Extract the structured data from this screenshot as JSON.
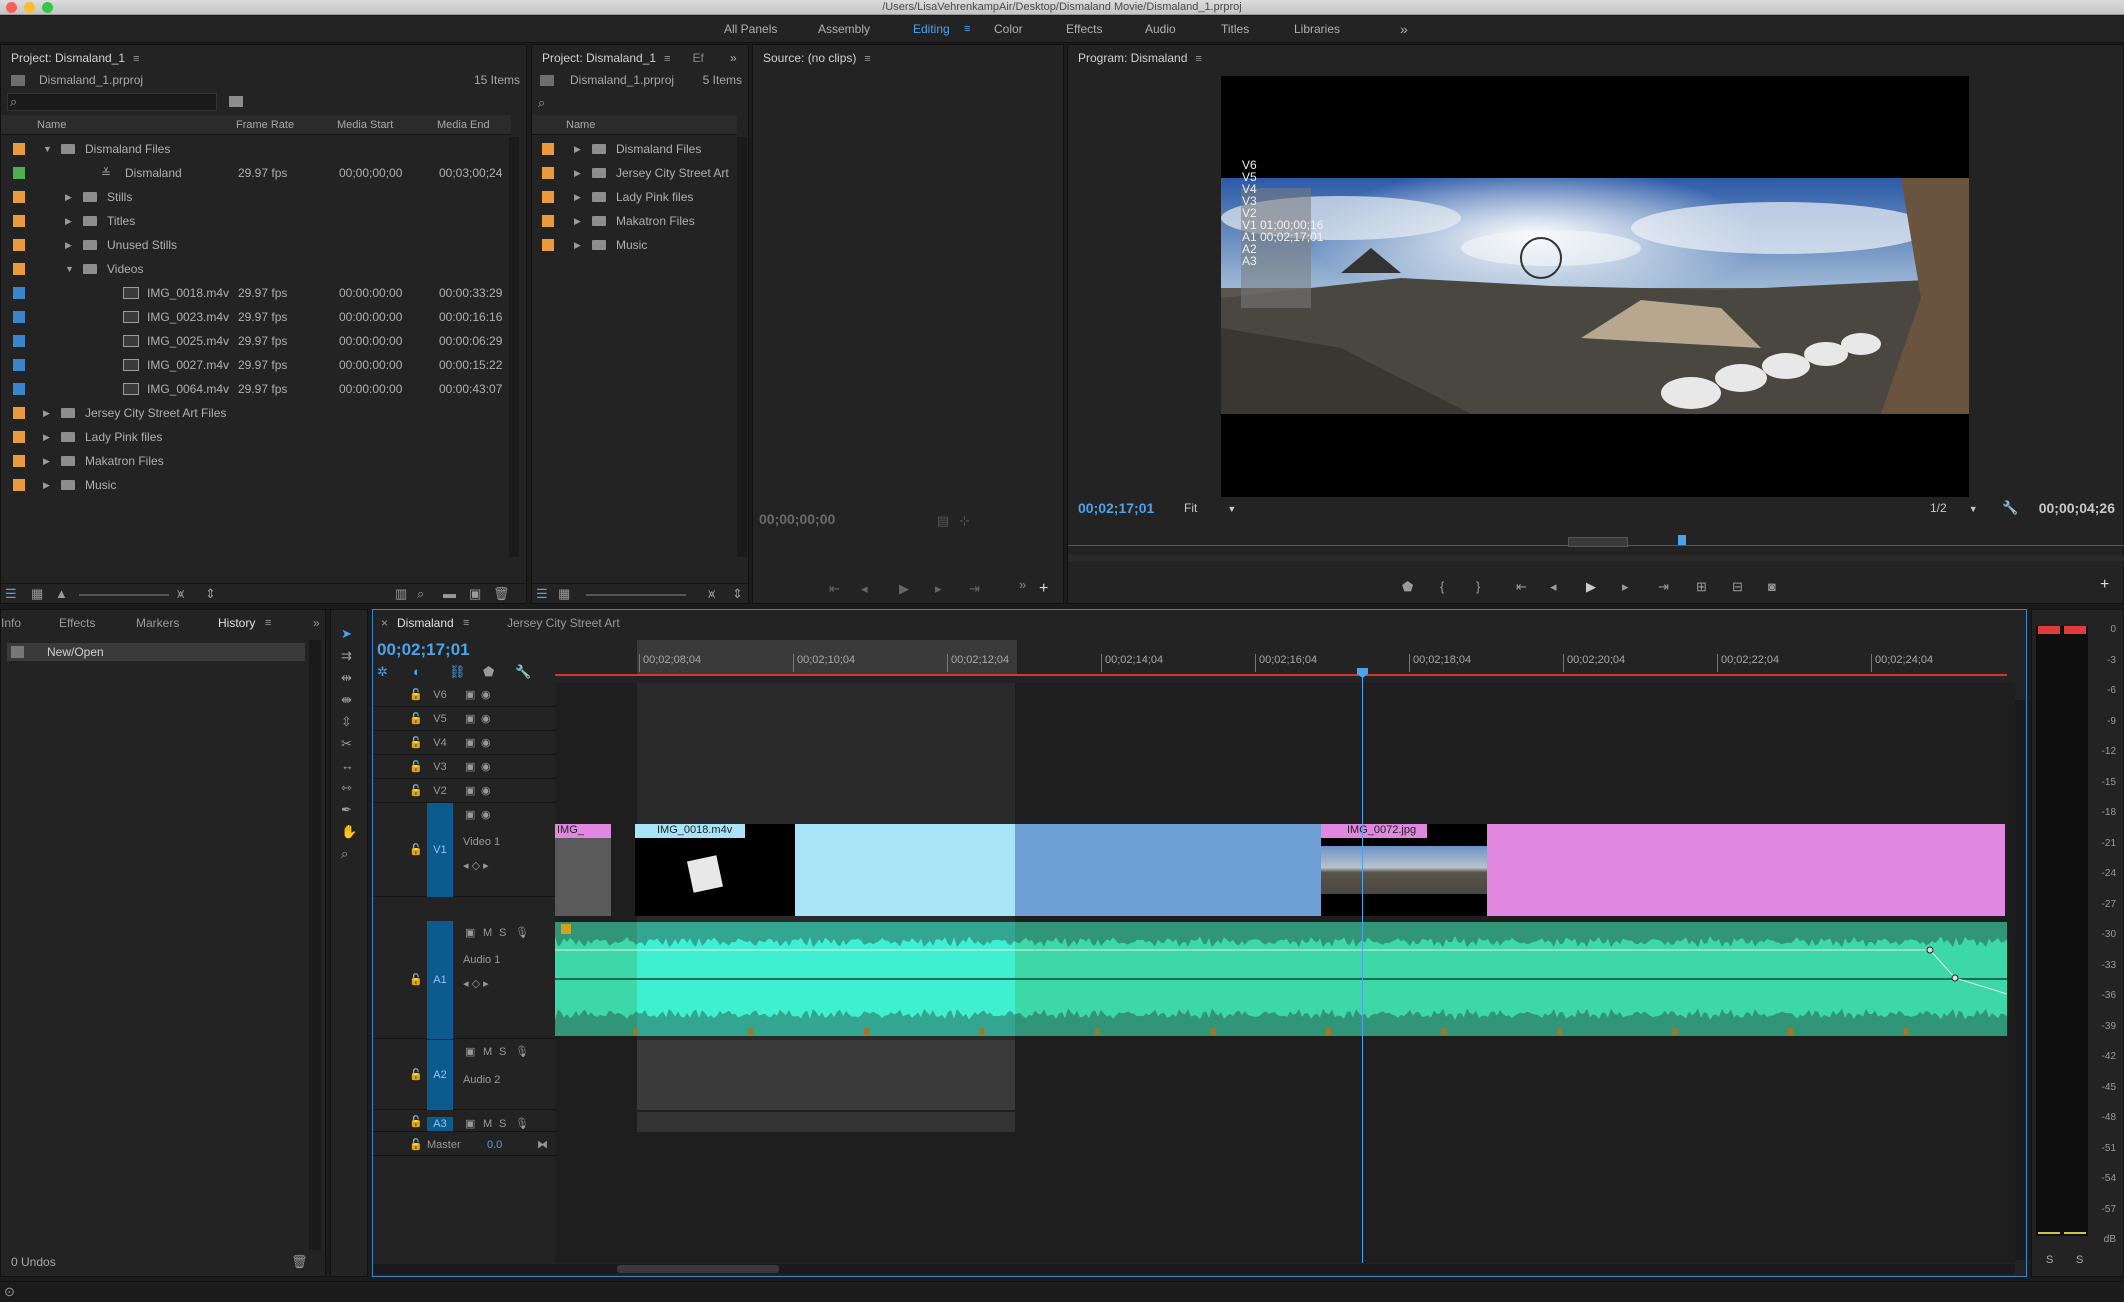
{
  "window_title": "/Users/LisaVehrenkampAir/Desktop/Dismaland Movie/Dismaland_1.prproj",
  "workspaces": [
    "All Panels",
    "Assembly",
    "Editing",
    "Color",
    "Effects",
    "Audio",
    "Titles",
    "Libraries"
  ],
  "active_workspace": "Editing",
  "overflow_glyph": "»",
  "project1": {
    "title": "Project: Dismaland_1",
    "file": "Dismaland_1.prproj",
    "count": "15 Items",
    "columns": [
      "Name",
      "Frame Rate",
      "Media Start",
      "Media End"
    ],
    "rows": [
      {
        "name": "Dismaland Files",
        "indent": 0,
        "type": "folder",
        "open": true,
        "color": "#e89a3c",
        "rate": "",
        "start": "",
        "end": ""
      },
      {
        "name": "Dismaland",
        "indent": 1,
        "type": "sequence",
        "open": false,
        "color": "#4cb050",
        "rate": "29.97 fps",
        "start": "00;00;00;00",
        "end": "00;03;00;24"
      },
      {
        "name": "Stills",
        "indent": 1,
        "type": "folder",
        "open": false,
        "color": "#e89a3c",
        "rate": "",
        "start": "",
        "end": ""
      },
      {
        "name": "Titles",
        "indent": 1,
        "type": "folder",
        "open": false,
        "color": "#e89a3c",
        "rate": "",
        "start": "",
        "end": ""
      },
      {
        "name": "Unused Stills",
        "indent": 1,
        "type": "folder",
        "open": false,
        "color": "#e89a3c",
        "rate": "",
        "start": "",
        "end": ""
      },
      {
        "name": "Videos",
        "indent": 1,
        "type": "folder",
        "open": true,
        "color": "#e89a3c",
        "rate": "",
        "start": "",
        "end": ""
      },
      {
        "name": "IMG_0018.m4v",
        "indent": 2,
        "type": "clip",
        "open": false,
        "color": "#3a86c8",
        "rate": "29.97 fps",
        "start": "00:00:00:00",
        "end": "00:00:33:29"
      },
      {
        "name": "IMG_0023.m4v",
        "indent": 2,
        "type": "clip",
        "open": false,
        "color": "#3a86c8",
        "rate": "29.97 fps",
        "start": "00:00:00:00",
        "end": "00:00:16:16"
      },
      {
        "name": "IMG_0025.m4v",
        "indent": 2,
        "type": "clip",
        "open": false,
        "color": "#3a86c8",
        "rate": "29.97 fps",
        "start": "00:00:00:00",
        "end": "00:00:06:29"
      },
      {
        "name": "IMG_0027.m4v",
        "indent": 2,
        "type": "clip",
        "open": false,
        "color": "#3a86c8",
        "rate": "29.97 fps",
        "start": "00:00:00:00",
        "end": "00:00:15:22"
      },
      {
        "name": "IMG_0064.m4v",
        "indent": 2,
        "type": "clip",
        "open": false,
        "color": "#3a86c8",
        "rate": "29.97 fps",
        "start": "00:00:00:00",
        "end": "00:00:43:07"
      },
      {
        "name": "Jersey City Street Art Files",
        "indent": 0,
        "type": "folder",
        "open": false,
        "color": "#e89a3c",
        "rate": "",
        "start": "",
        "end": ""
      },
      {
        "name": "Lady Pink files",
        "indent": 0,
        "type": "folder",
        "open": false,
        "color": "#e89a3c",
        "rate": "",
        "start": "",
        "end": ""
      },
      {
        "name": "Makatron Files",
        "indent": 0,
        "type": "folder",
        "open": false,
        "color": "#e89a3c",
        "rate": "",
        "start": "",
        "end": ""
      },
      {
        "name": "Music",
        "indent": 0,
        "type": "folder",
        "open": false,
        "color": "#e89a3c",
        "rate": "",
        "start": "",
        "end": ""
      }
    ]
  },
  "project2": {
    "title": "Project: Dismaland_1",
    "extra_tab": "Ef",
    "file": "Dismaland_1.prproj",
    "count": "5 Items",
    "column": "Name",
    "rows": [
      "Dismaland Files",
      "Jersey City Street Art",
      "Lady Pink files",
      "Makatron Files",
      "Music"
    ]
  },
  "source": {
    "title": "Source: (no clips)",
    "timecode": "00;00;00;00"
  },
  "program": {
    "title": "Program: Dismaland",
    "timecode": "00;02;17;01",
    "fit": "Fit",
    "resolution": "1/2",
    "duration": "00;00;04;26",
    "overlay": [
      "V6",
      "V5",
      "V4",
      "V3",
      "V2",
      "V1 01;00;00;16",
      "A1 00;02;17;01",
      "A2",
      "A3"
    ]
  },
  "lower_left": {
    "tabs": [
      "Info",
      "Effects",
      "Markers",
      "History"
    ],
    "active_tab": "History",
    "history_item": "New/Open",
    "undos": "0 Undos"
  },
  "timeline": {
    "tabs": [
      "Dismaland",
      "Jersey City Street Art"
    ],
    "active_tab": "Dismaland",
    "close_glyph": "×",
    "timecode": "00;02;17;01",
    "ruler": [
      "00;02;08;04",
      "00;02;10;04",
      "00;02;12;04",
      "00;02;14;04",
      "00;02;16;04",
      "00;02;18;04",
      "00;02;20;04",
      "00;02;22;04",
      "00;02;24;04"
    ],
    "tracks": [
      {
        "id": "V6",
        "name": ""
      },
      {
        "id": "V5",
        "name": ""
      },
      {
        "id": "V4",
        "name": ""
      },
      {
        "id": "V3",
        "name": ""
      },
      {
        "id": "V2",
        "name": ""
      },
      {
        "id": "V1",
        "name": "Video 1"
      },
      {
        "id": "A1",
        "name": "Audio 1"
      },
      {
        "id": "A2",
        "name": "Audio 2"
      },
      {
        "id": "A3",
        "name": ""
      }
    ],
    "msr": [
      "M",
      "S"
    ],
    "master_label": "Master",
    "master_value": "0.0",
    "clips": [
      {
        "label": "IMG_",
        "track": "V1",
        "color": "#e088e0"
      },
      {
        "label": "IMG_0018.m4v",
        "track": "V1",
        "color": "#a8e4f8"
      },
      {
        "label": "IMG_0072.jpg",
        "track": "V1",
        "color": "#e088e0"
      }
    ]
  },
  "meter": {
    "scale": [
      "0",
      "-3",
      "-6",
      "-9",
      "-12",
      "-15",
      "-18",
      "-21",
      "-24",
      "-27",
      "-30",
      "-33",
      "-36",
      "-39",
      "-42",
      "-45",
      "-48",
      "-51",
      "-54",
      "-57",
      "dB"
    ],
    "solo": [
      "S",
      "S"
    ]
  },
  "colors": {
    "accent": "#4aa3ec",
    "audio": "#3dd8a8",
    "audio_hl": "#3ff0d0",
    "video_light": "#a8e4f8",
    "video_blue": "#6d9fd4",
    "pink": "#e088e0"
  }
}
